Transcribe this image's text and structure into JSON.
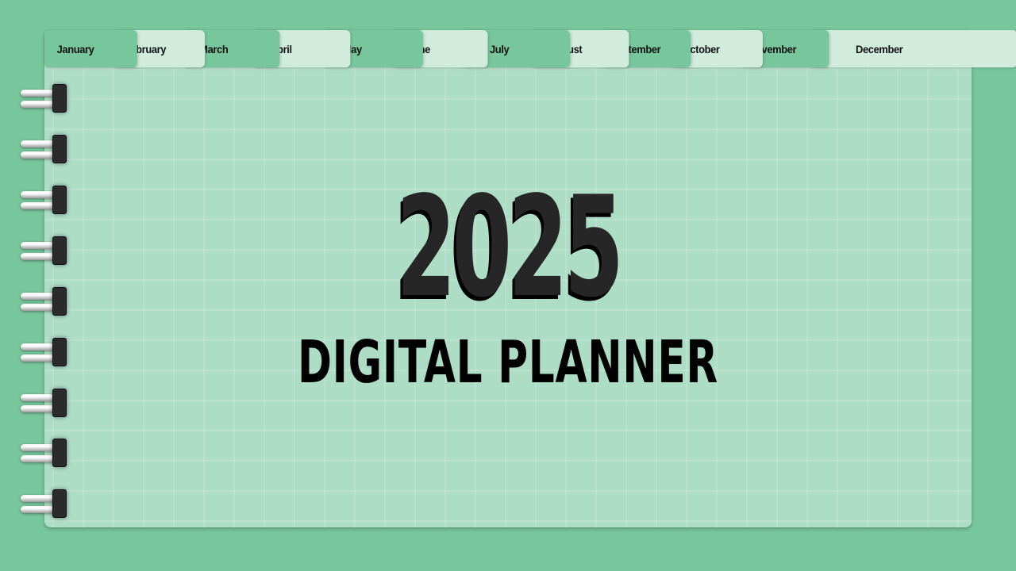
{
  "tabs": [
    {
      "label": "January",
      "style": "dark"
    },
    {
      "label": "February",
      "style": "light"
    },
    {
      "label": "March",
      "style": "dark"
    },
    {
      "label": "April",
      "style": "light"
    },
    {
      "label": "May",
      "style": "dark"
    },
    {
      "label": "June",
      "style": "light"
    },
    {
      "label": "July",
      "style": "dark"
    },
    {
      "label": "August",
      "style": "light"
    },
    {
      "label": "September",
      "style": "dark"
    },
    {
      "label": "October",
      "style": "light"
    },
    {
      "label": "November",
      "style": "dark"
    },
    {
      "label": "December",
      "style": "light"
    }
  ],
  "cover": {
    "year": "2025",
    "title": "DIGITAL PLANNER"
  },
  "binding": {
    "ring_count": 9,
    "icon": "spiral-ring-icon"
  },
  "colors": {
    "background": "#78c69c",
    "page": "#aeddc6",
    "tab_dark": "#78c69c",
    "tab_light": "#d1ebdd",
    "text": "#111111"
  }
}
